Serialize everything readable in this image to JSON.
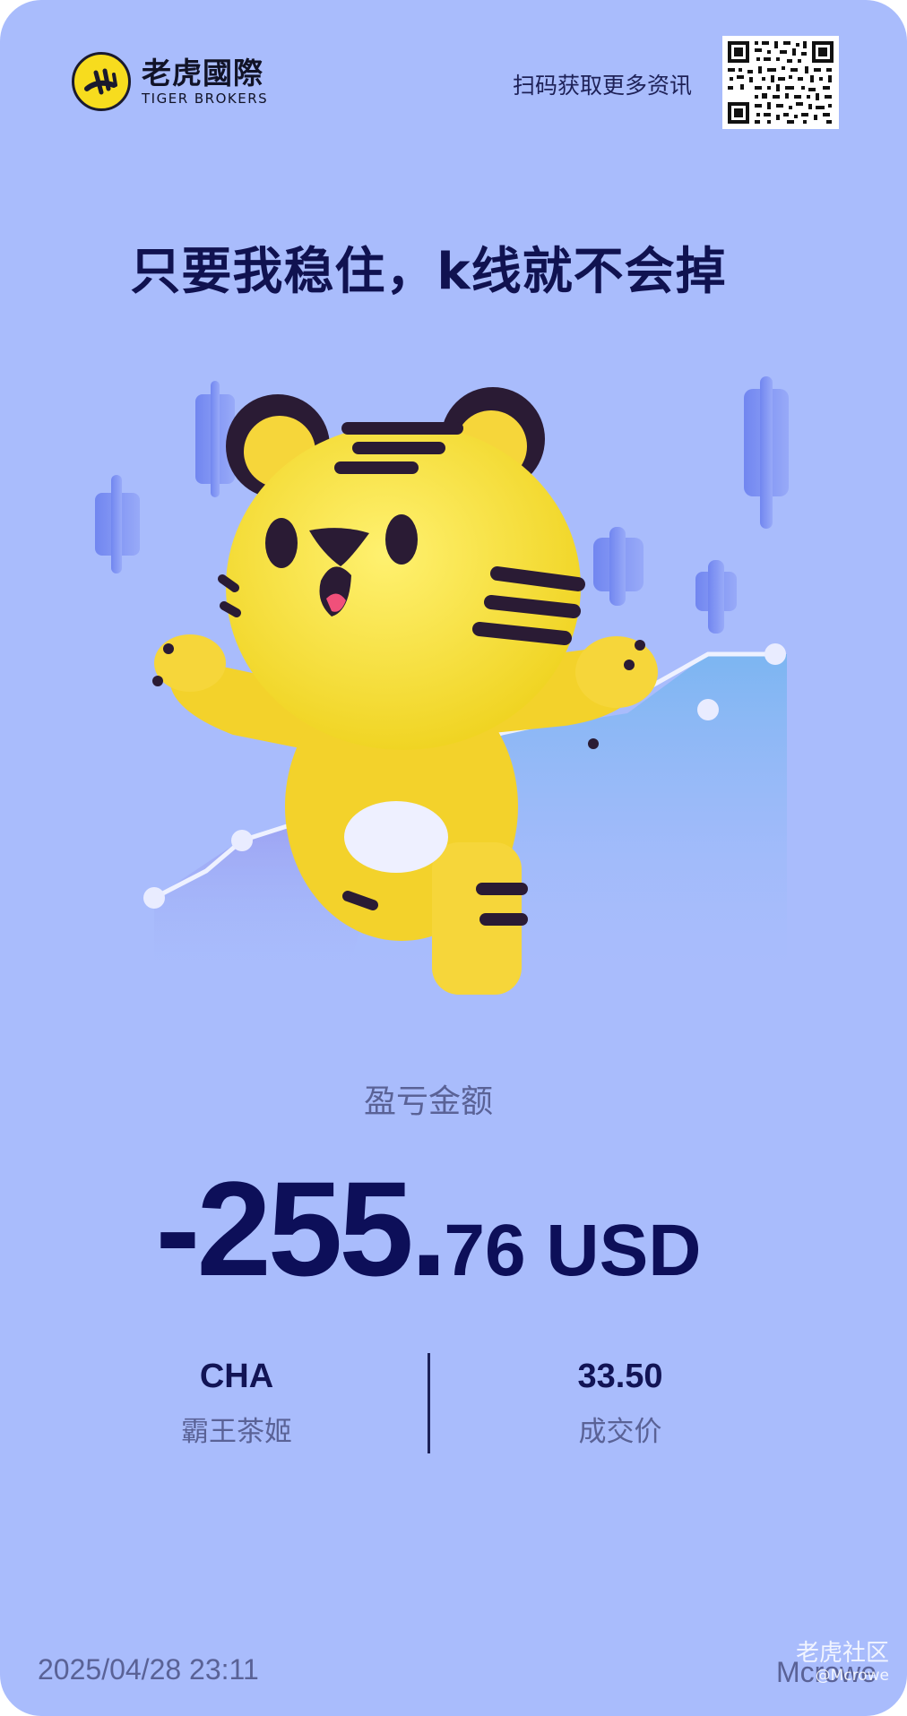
{
  "brand": {
    "name": "老虎國際",
    "name_en": "TIGER BROKERS"
  },
  "header": {
    "scan_label": "扫码获取更多资讯"
  },
  "headline": "只要我稳住，k线就不会掉",
  "pnl": {
    "label": "盈亏金额",
    "integer": "-255.",
    "decimal": "76 USD"
  },
  "trade": {
    "ticker": "CHA",
    "stock_name": "霸王茶姬",
    "price": "33.50",
    "price_label": "成交价"
  },
  "footer": {
    "timestamp": "2025/04/28 23:11",
    "username": "Mcrowe",
    "watermark_main": "老虎社区",
    "watermark_sub": "@Mcrowe"
  },
  "colors": {
    "background": "#a9bcfc",
    "text_dark": "#0d0f59",
    "text_muted": "#5a6296",
    "tiger_yellow": "#f7dc1e"
  },
  "icons": {
    "logo": "tiger-logo-icon",
    "qr": "qr-code-icon",
    "mascot": "tiger-mascot-icon"
  }
}
